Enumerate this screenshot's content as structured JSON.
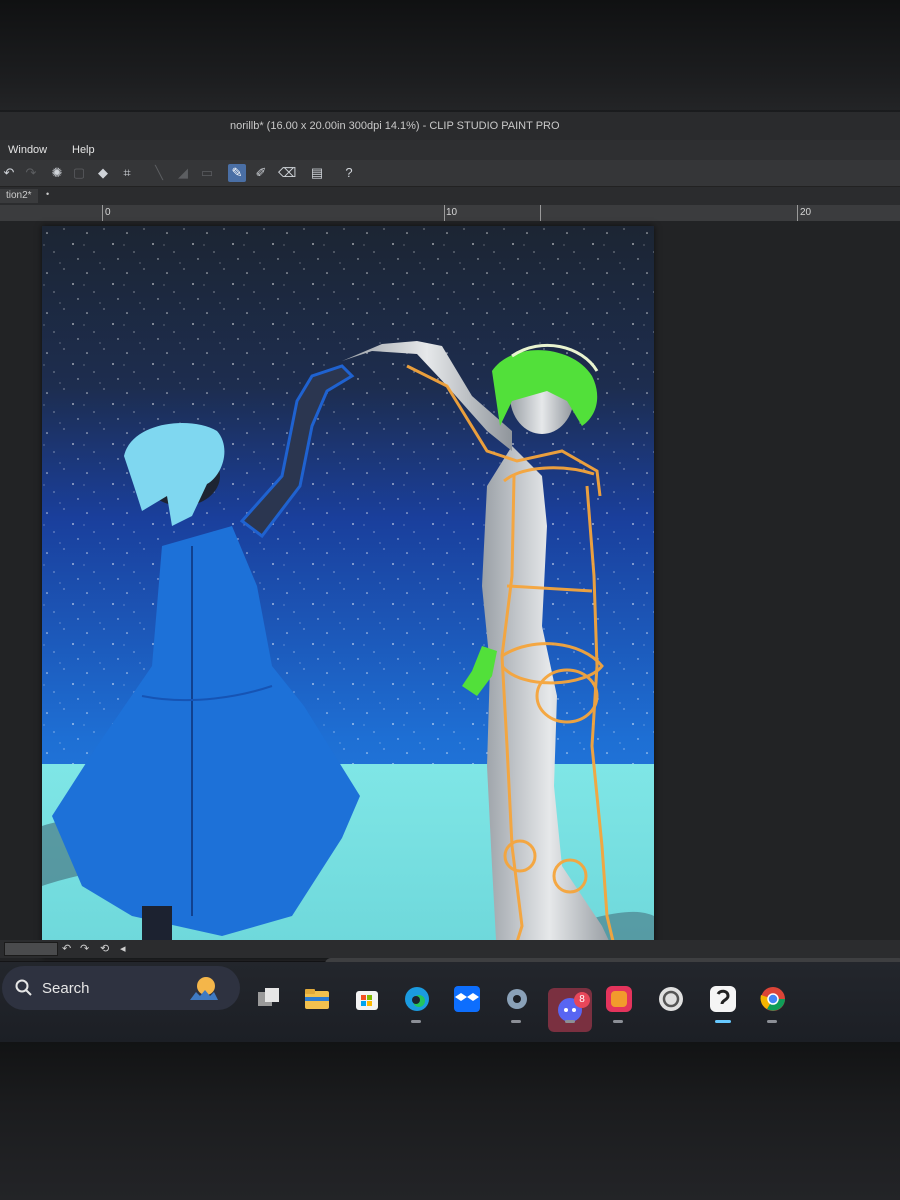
{
  "window": {
    "title": "norillb* (16.00 x 20.00in 300dpi 14.1%)  - CLIP STUDIO PAINT PRO"
  },
  "menu": {
    "items": [
      "Window",
      "Help"
    ]
  },
  "document": {
    "tab_label": "tion2*",
    "tab_close": "•"
  },
  "ruler": {
    "labels": [
      "0",
      "10",
      "20"
    ]
  },
  "toolbar": {
    "icons": [
      "undo-icon",
      "redo-icon",
      "selection-icon",
      "fill-icon",
      "transform-icon",
      "pen-icon",
      "brush-icon",
      "eraser-icon",
      "sidebar-icon",
      "help-icon"
    ],
    "active": "pen-icon"
  },
  "taskbar": {
    "search_label": "Search",
    "apps": [
      {
        "name": "task-view",
        "color": "#d9d9d9"
      },
      {
        "name": "file-explorer",
        "color": "#f2c14e"
      },
      {
        "name": "microsoft-store",
        "color": "#ffffff"
      },
      {
        "name": "edge",
        "color": "#1b9be0"
      },
      {
        "name": "dropbox",
        "color": "#0d6efd"
      },
      {
        "name": "settings",
        "color": "#8aa1b8"
      },
      {
        "name": "discord",
        "color": "#5865f2",
        "badge": "8"
      },
      {
        "name": "adobe-creative-cloud",
        "color": "#e4345c"
      },
      {
        "name": "clip-studio",
        "color": "#e0e0e0"
      },
      {
        "name": "clip-studio-paint",
        "color": "#ffffff"
      },
      {
        "name": "chrome",
        "color": "#34a853"
      }
    ]
  },
  "colors": {
    "sky_top": "#1e2a3c",
    "sky_bottom": "#1f6fd6",
    "ground": "#7fe3e4",
    "dress": "#1d71d8",
    "hair_left": "#7fd7f0",
    "hair_right": "#52e03a",
    "guide_lines": "#f6a53b"
  }
}
